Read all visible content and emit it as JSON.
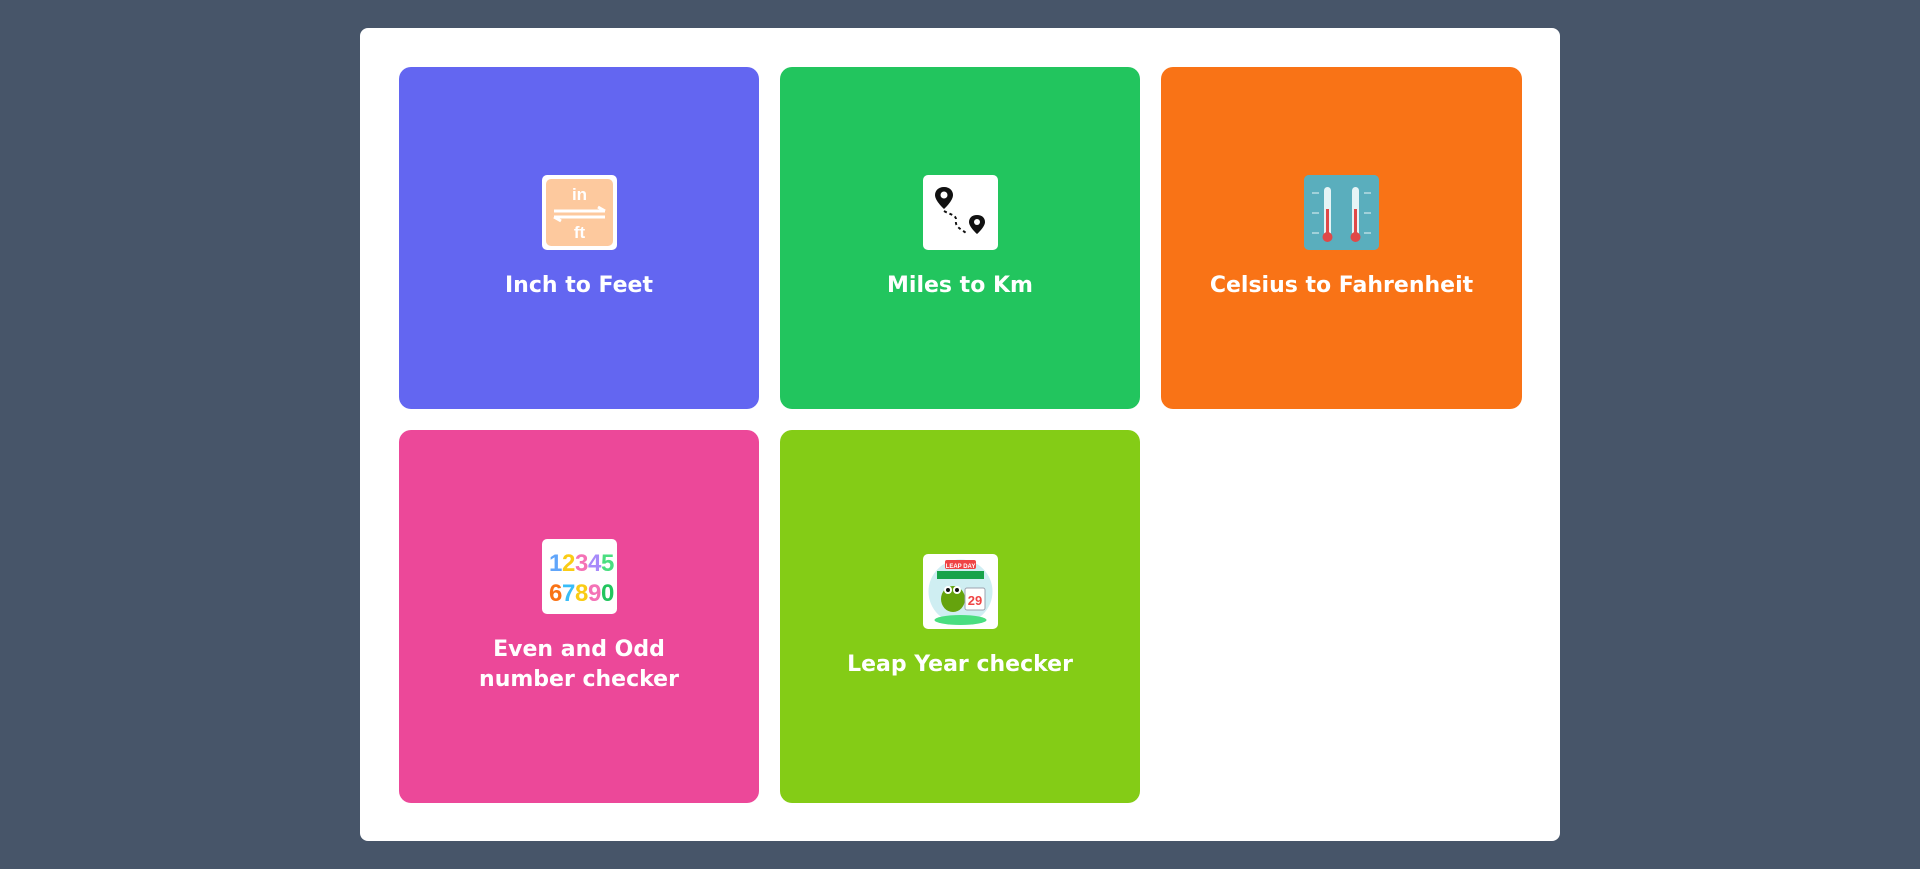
{
  "cards": [
    {
      "label": "Inch to Feet",
      "color": "#6366f1",
      "icon": "inch-feet-icon",
      "icon_text": [
        "in",
        "ft"
      ]
    },
    {
      "label": "Miles to Km",
      "color": "#22c55e",
      "icon": "map-route-icon"
    },
    {
      "label": "Celsius to Fahrenheit",
      "color": "#f97316",
      "icon": "thermometer-icon"
    },
    {
      "label": "Even and Odd number checker",
      "color": "#ec4899",
      "icon": "numbers-icon",
      "icon_text": [
        "1",
        "2",
        "3",
        "4",
        "5",
        "6",
        "7",
        "8",
        "9",
        "0"
      ]
    },
    {
      "label": "Leap Year checker",
      "color": "#84cc16",
      "icon": "leap-day-calendar-icon",
      "icon_text": [
        "LEAP DAY",
        "29"
      ]
    }
  ]
}
